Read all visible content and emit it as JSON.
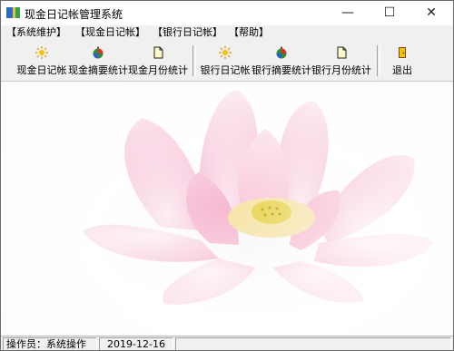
{
  "window": {
    "title": "现金日记帐管理系统"
  },
  "menu": [
    {
      "label": "【系统维护】"
    },
    {
      "label": "【现金日记帐】"
    },
    {
      "label": "【银行日记帐】"
    },
    {
      "label": "【帮助】"
    }
  ],
  "toolbar": {
    "buttons": [
      {
        "label": "现金日记帐",
        "icon": "sun-icon"
      },
      {
        "label": "现金摘要统计",
        "icon": "ball-icon"
      },
      {
        "label": "现金月份统计",
        "icon": "document-icon"
      },
      {
        "label": "银行日记帐",
        "icon": "sun-icon"
      },
      {
        "label": "银行摘要统计",
        "icon": "ball-icon"
      },
      {
        "label": "银行月份统计",
        "icon": "document-icon"
      },
      {
        "label": "退出",
        "icon": "exit-door-icon"
      }
    ]
  },
  "status": {
    "operator": "操作员：系统操作员",
    "date": "2019-12-16"
  },
  "colors": {
    "petal": "#f7bfd6",
    "petal_light": "#fde4ee",
    "center": "#f4e08a"
  }
}
